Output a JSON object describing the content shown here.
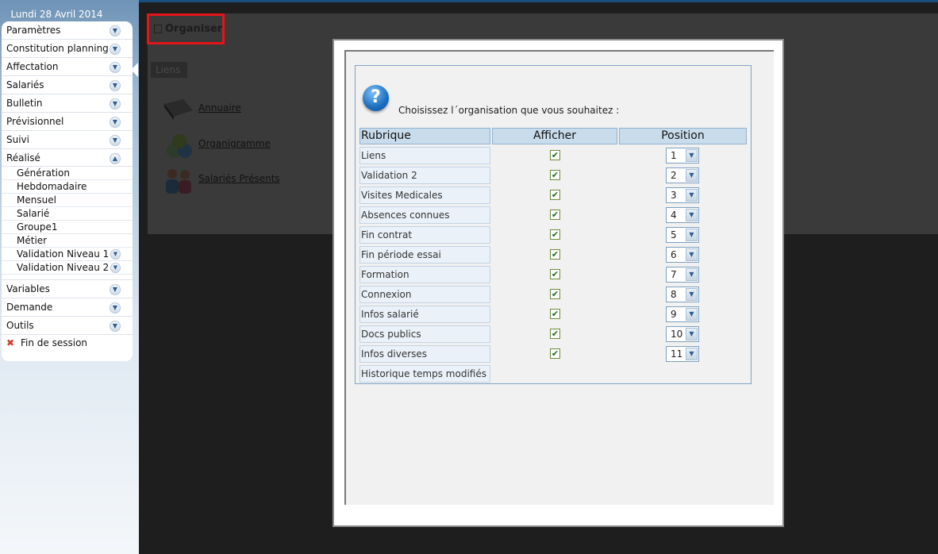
{
  "sidebar": {
    "date": "Lundi 28 Avril 2014",
    "menu_before": [
      {
        "label": "Paramètres"
      },
      {
        "label": "Constitution planning"
      },
      {
        "label": "Affectation"
      },
      {
        "label": "Salariés"
      },
      {
        "label": "Bulletin"
      },
      {
        "label": "Prévisionnel"
      },
      {
        "label": "Suivi"
      }
    ],
    "expanded": {
      "label": "Réalisé"
    },
    "submenu": [
      {
        "label": "Génération",
        "has_chevron": false
      },
      {
        "label": "Hebdomadaire",
        "has_chevron": false
      },
      {
        "label": "Mensuel",
        "has_chevron": false
      },
      {
        "label": "Salarié",
        "has_chevron": false
      },
      {
        "label": "Groupe1",
        "has_chevron": false
      },
      {
        "label": "Métier",
        "has_chevron": false
      },
      {
        "label": "Validation Niveau 1",
        "has_chevron": true
      },
      {
        "label": "Validation Niveau 2",
        "has_chevron": true
      }
    ],
    "menu_after": [
      {
        "label": "Variables"
      },
      {
        "label": "Demande"
      },
      {
        "label": "Outils"
      }
    ],
    "logout": "Fin de session"
  },
  "main": {
    "active_tab": "Organiser",
    "section_tab": "Liens",
    "links": [
      {
        "label": "Annuaire",
        "icon": "address-book-icon"
      },
      {
        "label": "Organigramme",
        "icon": "org-chart-icon"
      },
      {
        "label": "Salariés Présents",
        "icon": "people-icon"
      }
    ]
  },
  "modal": {
    "prompt": "Choisissez l´organisation que vous souhaitez :",
    "headers": {
      "rubrique": "Rubrique",
      "afficher": "Afficher",
      "position": "Position"
    },
    "rows": [
      {
        "rubrique": "Liens",
        "checked": true,
        "position": "1"
      },
      {
        "rubrique": "Validation 2",
        "checked": true,
        "position": "2"
      },
      {
        "rubrique": "Visites Medicales",
        "checked": true,
        "position": "3"
      },
      {
        "rubrique": "Absences connues",
        "checked": true,
        "position": "4"
      },
      {
        "rubrique": "Fin contrat",
        "checked": true,
        "position": "5"
      },
      {
        "rubrique": "Fin période essai",
        "checked": true,
        "position": "6"
      },
      {
        "rubrique": "Formation",
        "checked": true,
        "position": "7"
      },
      {
        "rubrique": "Connexion",
        "checked": true,
        "position": "8"
      },
      {
        "rubrique": "Infos salarié",
        "checked": true,
        "position": "9"
      },
      {
        "rubrique": "Docs publics",
        "checked": true,
        "position": "10"
      },
      {
        "rubrique": "Infos diverses",
        "checked": true,
        "position": "11"
      },
      {
        "rubrique": "Historique temps modifiés",
        "checked": null,
        "position": null
      }
    ]
  },
  "colors": {
    "highlight": "#e3141a",
    "accent": "#1c6ec0",
    "header_bg": "#c9dcec"
  }
}
